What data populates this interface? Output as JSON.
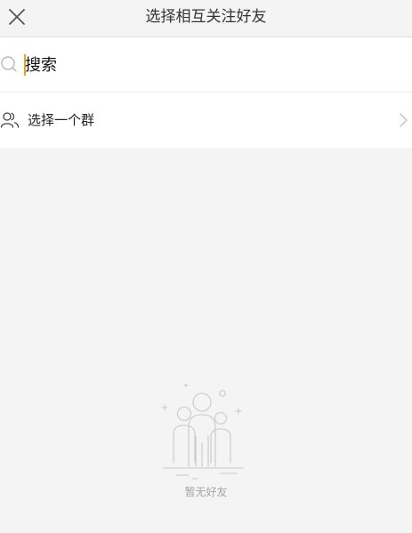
{
  "header": {
    "title": "选择相互关注好友",
    "close_icon": "close-icon"
  },
  "search": {
    "placeholder": "搜索",
    "value": "",
    "icon": "search-icon"
  },
  "group_option": {
    "label": "选择一个群",
    "icon": "group-user-icon",
    "chevron": "chevron-right-icon"
  },
  "empty_state": {
    "message": "暂无好友",
    "illustration": "people-group-illustration"
  },
  "colors": {
    "background": "#f4f4f4",
    "surface": "#ffffff",
    "caret": "#f0a020",
    "muted_text": "#a5a5a5"
  }
}
